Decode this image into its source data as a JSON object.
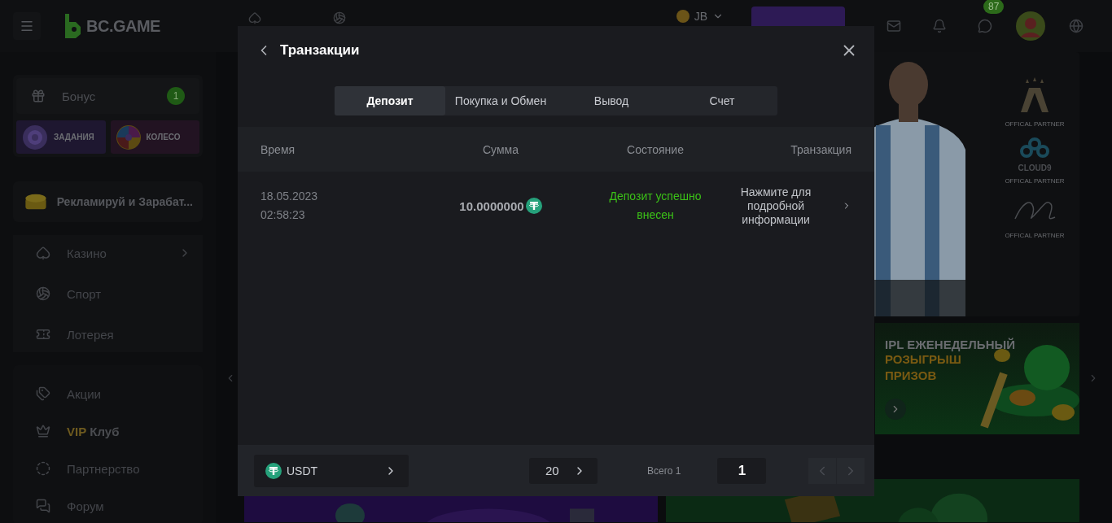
{
  "header": {
    "logo": "BC.GAME",
    "currency": "JB",
    "chat_badge": "87"
  },
  "sidebar": {
    "bonus": {
      "label": "Бонус",
      "badge": "1"
    },
    "tiles": [
      {
        "label": "ЗАДАНИЯ",
        "kind": "target"
      },
      {
        "label": "КОЛЕСО",
        "kind": "wheel"
      }
    ],
    "promo": "Рекламируй и Зарабат...",
    "games": [
      {
        "label": "Казино",
        "kind": "casino",
        "arrow": true
      },
      {
        "label": "Спорт",
        "kind": "sport",
        "arrow": false
      },
      {
        "label": "Лотерея",
        "kind": "lottery",
        "arrow": false
      }
    ],
    "links": [
      {
        "label": "Акции",
        "kind": "promos"
      },
      {
        "accent": "VIP",
        "label": "Клуб",
        "kind": "vip"
      },
      {
        "label": "Партнерство",
        "kind": "partner"
      },
      {
        "label": "Форум",
        "kind": "forum"
      }
    ]
  },
  "hero": {
    "partners": [
      {
        "kind": "afa",
        "caption": "OFFICAL PARTNER"
      },
      {
        "kind": "cloud9",
        "logo": "CLOUD9",
        "caption": "OFFICAL PARTNER"
      },
      {
        "kind": "signature",
        "caption": "OFFICAL PARTNER"
      }
    ]
  },
  "ipl_banner": {
    "title": "IPL ЕЖЕНЕДЕЛЬНЫЙ",
    "highlight": "РОЗЫГРЫШ ПРИЗОВ"
  },
  "modal": {
    "title": "Транзакции",
    "tabs": [
      {
        "label": "Депозит",
        "selected": true
      },
      {
        "label": "Покупка и Обмен",
        "selected": false
      },
      {
        "label": "Вывод",
        "selected": false
      },
      {
        "label": "Счет",
        "selected": false
      }
    ],
    "columns": [
      "Время",
      "Сумма",
      "Состояние",
      "Транзакция"
    ],
    "rows": [
      {
        "date": "18.05.2023",
        "time": "02:58:23",
        "amount": "**10.**0000000",
        "status": "Депозит успешно внесен",
        "kind": "success",
        "details": "Нажмите для подробной информации"
      }
    ],
    "footer": {
      "currency": "USDT",
      "page_size": "20",
      "total": "Всего 1",
      "page": "1"
    }
  }
}
